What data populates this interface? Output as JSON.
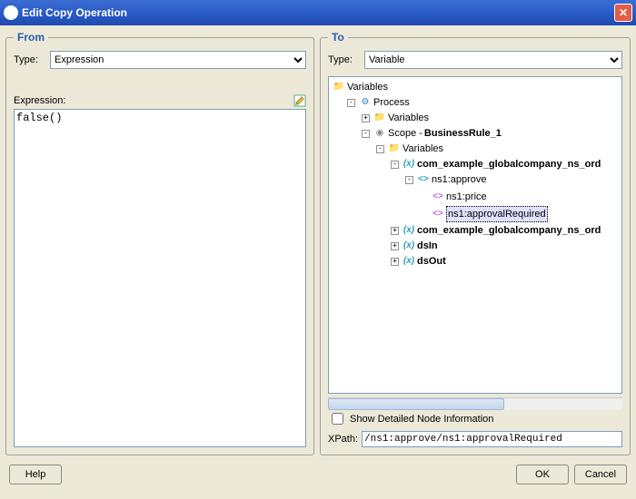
{
  "window": {
    "title": "Edit Copy Operation"
  },
  "from": {
    "legend": "From",
    "type_label": "Type:",
    "type_value": "Expression",
    "expression_label": "Expression:",
    "expression_value": "false()"
  },
  "to": {
    "legend": "To",
    "type_label": "Type:",
    "type_value": "Variable",
    "tree": {
      "root": "Variables",
      "process": "Process",
      "process_variables": "Variables",
      "scope": "Scope - ",
      "scope_name": "BusinessRule_1",
      "scope_variables": "Variables",
      "var1": "com_example_globalcompany_ns_ord",
      "approve": "ns1:approve",
      "price": "ns1:price",
      "approvalRequired": "ns1:approvalRequired",
      "var2": "com_example_globalcompany_ns_ord",
      "dsIn": "dsIn",
      "dsOut": "dsOut"
    },
    "show_detailed_label": "Show Detailed Node Information",
    "xpath_label": "XPath:",
    "xpath_value": "/ns1:approve/ns1:approvalRequired"
  },
  "footer": {
    "help": "Help",
    "ok": "OK",
    "cancel": "Cancel"
  }
}
